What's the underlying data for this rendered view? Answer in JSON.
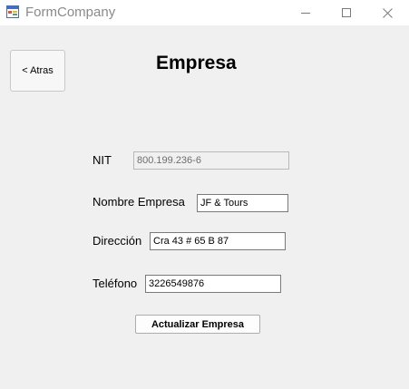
{
  "window": {
    "title": "FormCompany",
    "controls": {
      "minimize_icon": "minimize-icon",
      "maximize_icon": "maximize-icon",
      "close_icon": "close-icon"
    }
  },
  "form": {
    "back_button_label": "< Atras",
    "page_title": "Empresa",
    "nit": {
      "label": "NIT",
      "value": "800.199.236-6"
    },
    "nombre_empresa": {
      "label": "Nombre Empresa",
      "value": "JF & Tours"
    },
    "direccion": {
      "label": "Dirección",
      "value": "Cra 43 # 65 B 87"
    },
    "telefono": {
      "label": "Teléfono",
      "value": "3226549876"
    },
    "submit_label": "Actualizar Empresa"
  },
  "colors": {
    "form_background": "#f0f0f0",
    "titlebar_background": "#ffffff",
    "title_text": "#8a8a8a"
  }
}
